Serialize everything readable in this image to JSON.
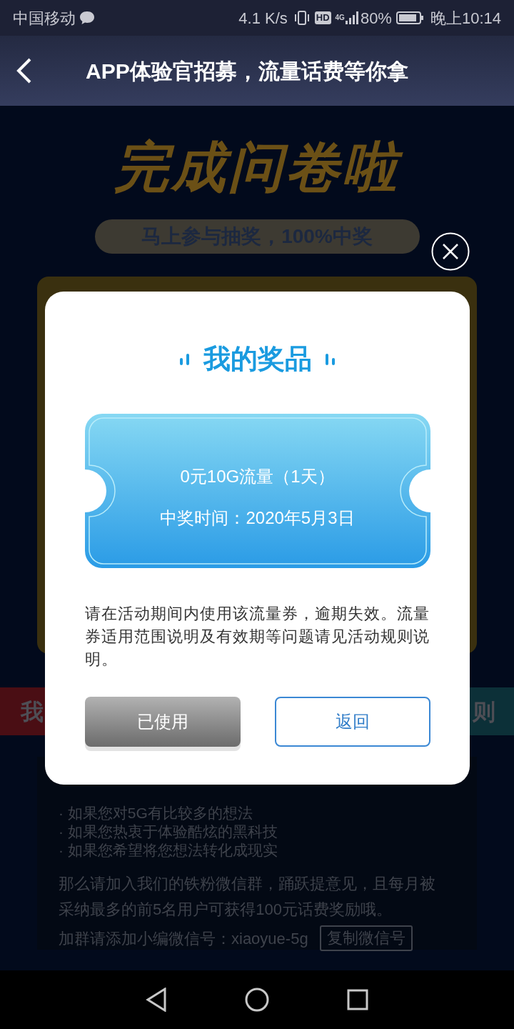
{
  "status_bar": {
    "carrier": "中国移动",
    "speed": "4.1 K/s",
    "hd": "HD",
    "network": "4G",
    "battery": "80%",
    "time": "晚上10:14"
  },
  "header": {
    "title": "APP体验官招募，流量话费等你拿"
  },
  "background": {
    "banner_title": "完成问卷啦",
    "banner_pill": "马上参与抽奖，100%中奖",
    "left_tab": "我",
    "right_tab": "则",
    "bullets": [
      "· 如果您对5G有比较多的想法",
      "· 如果您热衷于体验酷炫的黑科技",
      "· 如果您希望将您想法转化成现实"
    ],
    "paragraph": "那么请加入我们的铁粉微信群，踊跃提意见，且每月被采纳最多的前5名用户可获得100元话费奖励哦。",
    "wechat_label": "加群请添加小编微信号：xiaoyue-5g",
    "copy_button": "复制微信号"
  },
  "modal": {
    "title": "我的奖品",
    "prize": "0元10G流量（1天）",
    "won_time": "中奖时间：2020年5月3日",
    "note": "请在活动期间内使用该流量券，逾期失效。流量券适用范围说明及有效期等问题请见活动规则说明。",
    "buttons": [
      {
        "label": "已使用",
        "kind": "used"
      },
      {
        "label": "返回",
        "kind": "back"
      }
    ]
  }
}
